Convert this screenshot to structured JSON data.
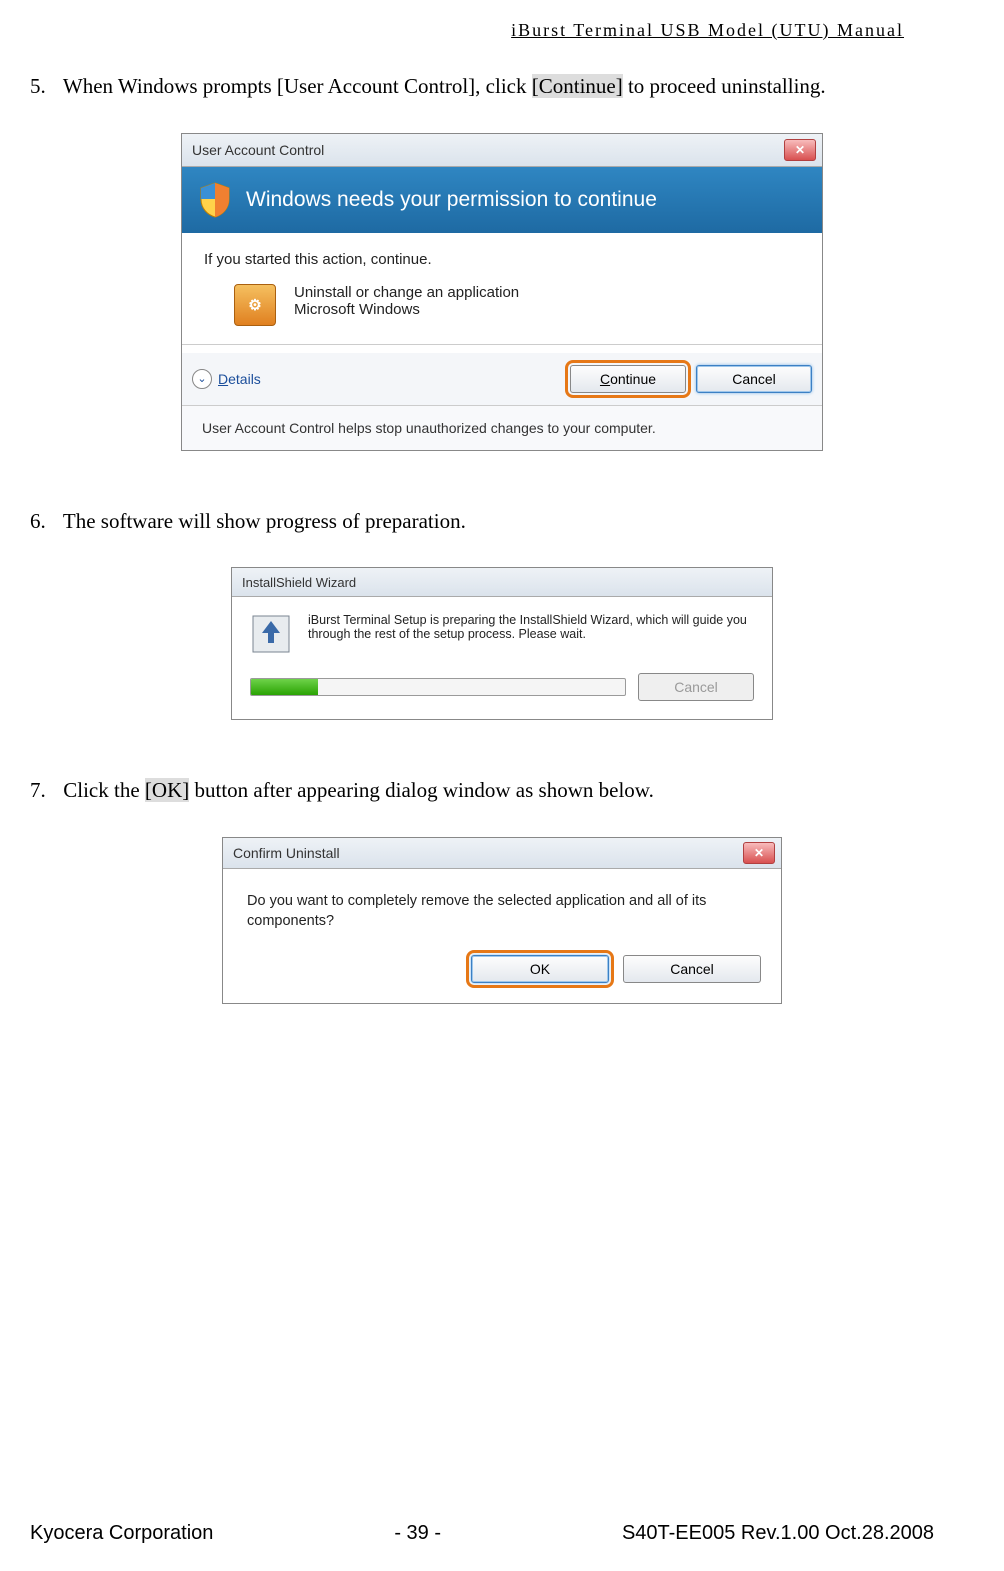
{
  "header": {
    "title": "iBurst  Terminal  USB  Model  (UTU)  Manual"
  },
  "steps": {
    "s5": {
      "num": "5.",
      "pre": "When Windows prompts [User Account Control], click ",
      "btn": "[Continue]",
      "post": " to proceed uninstalling."
    },
    "s6": {
      "num": "6.",
      "text": "The software will show progress of preparation."
    },
    "s7": {
      "num": "7.",
      "pre": "Click the ",
      "btn": "[OK]",
      "post": " button after appearing dialog window as shown below."
    }
  },
  "uac": {
    "title": "User Account Control",
    "banner": "Windows needs your permission to continue",
    "started": "If you started this action, continue.",
    "app_line1": "Uninstall or change an application",
    "app_line2": "Microsoft Windows",
    "details_char": "⌄",
    "details": "Details",
    "continue": "Continue",
    "cancel": "Cancel",
    "foot": "User Account Control helps stop unauthorized changes to your computer.",
    "close_glyph": "✕"
  },
  "ish": {
    "title": "InstallShield Wizard",
    "msg": "iBurst Terminal Setup is preparing the InstallShield Wizard, which will guide you through the rest of the setup process. Please wait.",
    "cancel": "Cancel"
  },
  "conf": {
    "title": "Confirm Uninstall",
    "msg": "Do you want to completely remove the selected application and all of its components?",
    "ok": "OK",
    "cancel": "Cancel",
    "close_glyph": "✕"
  },
  "footer": {
    "left": "Kyocera Corporation",
    "center": "- 39 -",
    "right": "S40T-EE005 Rev.1.00 Oct.28.2008"
  }
}
